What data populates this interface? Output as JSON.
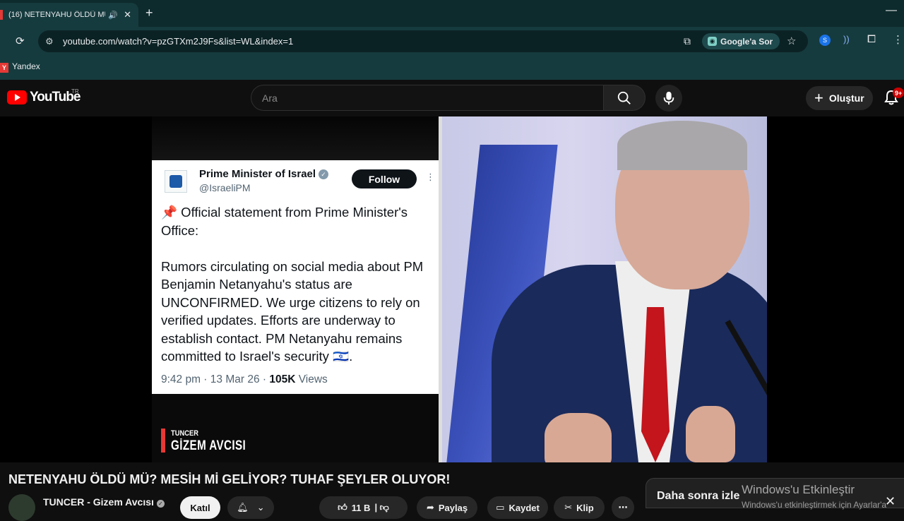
{
  "browser": {
    "tab_title": "(16) NETENYAHU ÖLDÜ MÜ",
    "url": "youtube.com/watch?v=pzGTXm2J9Fs&list=WL&index=1",
    "google_button": "Google'a Sor",
    "bookmark": "Yandex",
    "bookmark_icon_letter": "Y"
  },
  "youtube": {
    "logo_text": "YouTube",
    "region": "TR",
    "search_placeholder": "Ara",
    "create_label": "Oluştur",
    "notification_count": "9+"
  },
  "tweet": {
    "name": "Prime Minister of Israel",
    "handle": "@IsraeliPM",
    "follow_label": "Follow",
    "body": "📌 Official statement from Prime Minister's Office:\n\nRumors circulating on social media about PM Benjamin Netanyahu's status are UNCONFIRMED. We urge citizens to rely on verified updates. Efforts are underway to establish contact. PM Netanyahu remains committed to Israel's security 🇮🇱.",
    "meta_time": "9:42 pm · 13 Mar 26 · ",
    "meta_views_count": "105K",
    "meta_views_label": " Views"
  },
  "overlay_brand": {
    "top": "TUNCER",
    "main": "GİZEM AVCISI"
  },
  "video": {
    "title": "NETENYAHU ÖLDÜ MÜ? MESİH Mİ GELİYOR? TUHAF ŞEYLER OLUYOR!",
    "channel": "TUNCER - Gizem Avcısı",
    "join_label": "Katıl",
    "likes": "11 B",
    "share_label": "Paylaş",
    "save_label": "Kaydet",
    "clip_label": "Klip"
  },
  "watch_later": {
    "title": "Daha sonra izle"
  },
  "windows_activation": {
    "title": "Windows'u Etkinleştir",
    "subtitle": "Windows'u etkinleştirmek için Ayarlar'a"
  },
  "colors": {
    "youtube_red": "#ff0000",
    "browser_frame": "#163b3e",
    "background": "#0f0f0f"
  }
}
